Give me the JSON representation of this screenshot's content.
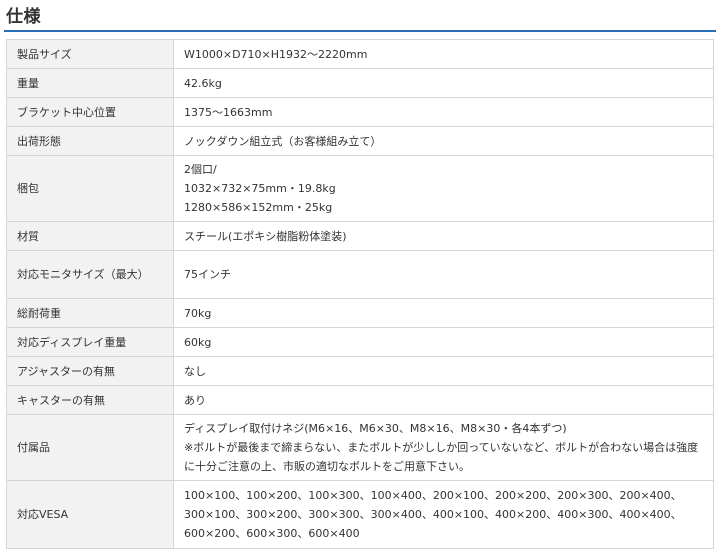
{
  "heading": "仕様",
  "rows": [
    {
      "label": "製品サイズ",
      "lines": [
        "W1000×D710×H1932〜2220mm"
      ]
    },
    {
      "label": "重量",
      "lines": [
        "42.6kg"
      ]
    },
    {
      "label": "ブラケット中心位置",
      "lines": [
        "1375〜1663mm"
      ]
    },
    {
      "label": "出荷形態",
      "lines": [
        "ノックダウン組立式（お客様組み立て）"
      ]
    },
    {
      "label": "梱包",
      "lines": [
        "2個口/",
        "1032×732×75mm・19.8kg",
        "1280×586×152mm・25kg"
      ]
    },
    {
      "label": "材質",
      "lines": [
        "スチール(エポキシ樹脂粉体塗装)"
      ]
    },
    {
      "label": "対応モニタサイズ（最大）",
      "lines": [
        "75インチ"
      ]
    },
    {
      "label": "総耐荷重",
      "lines": [
        "70kg"
      ]
    },
    {
      "label": "対応ディスプレイ重量",
      "lines": [
        "60kg"
      ]
    },
    {
      "label": "アジャスターの有無",
      "lines": [
        "なし"
      ]
    },
    {
      "label": "キャスターの有無",
      "lines": [
        "あり"
      ]
    },
    {
      "label": "付属品",
      "lines": [
        "ディスプレイ取付けネジ(M6×16、M6×30、M8×16、M8×30・各4本ずつ)",
        "※ボルトが最後まで締まらない、またボルトが少ししか回っていないなど、ボルトが合わない場合は強度に十分ご注意の上、市販の適切なボルトをご用意下さい。"
      ]
    },
    {
      "label": "対応VESA",
      "lines": [
        "100×100、100×200、100×300、100×400、200×100、200×200、200×300、200×400、300×100、300×200、300×300、300×400、400×100、400×200、400×300、400×400、600×200、600×300、600×400"
      ]
    }
  ]
}
